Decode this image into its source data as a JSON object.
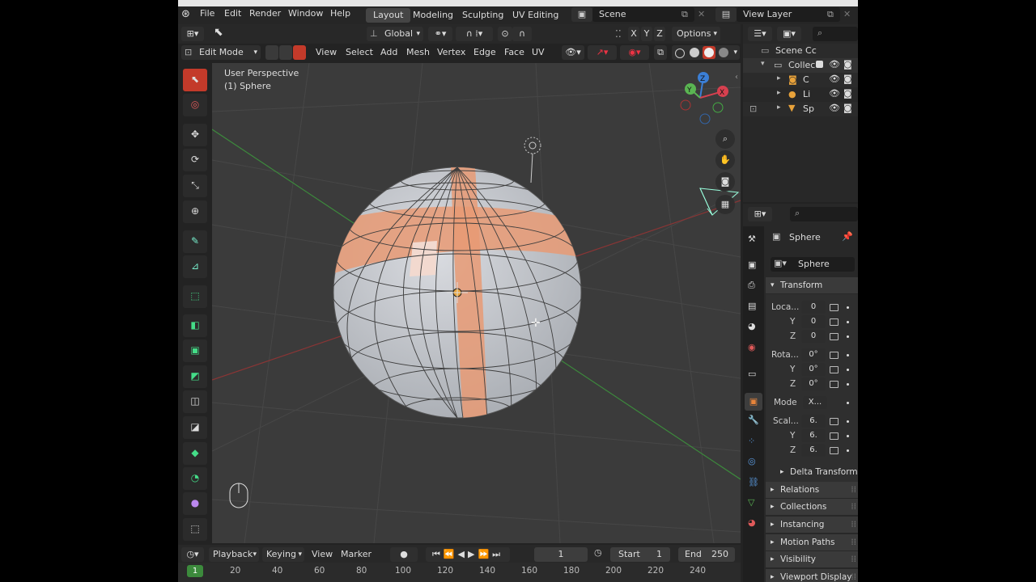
{
  "topbar": {
    "menus": [
      "File",
      "Edit",
      "Render",
      "Window",
      "Help"
    ],
    "workspaces": [
      "Layout",
      "Modeling",
      "Sculpting",
      "UV Editing"
    ],
    "scene_label": "Scene",
    "view_layer_label": "View Layer"
  },
  "tool_header": {
    "orientation": "Global",
    "options_label": "Options",
    "axes": [
      "X",
      "Y",
      "Z"
    ]
  },
  "viewport_header": {
    "mode": "Edit Mode",
    "menus": [
      "View",
      "Select",
      "Add",
      "Mesh",
      "Vertex",
      "Edge",
      "Face",
      "UV"
    ]
  },
  "viewport": {
    "perspective_label": "User Perspective",
    "object_label": "(1) Sphere"
  },
  "gizmo": {
    "x": "X",
    "y": "Y",
    "z": "Z"
  },
  "outliner": {
    "scene_collection": "Scene Cc",
    "collection": "Collec",
    "items": [
      "C",
      "Li",
      "Sp"
    ]
  },
  "properties": {
    "object_name": "Sphere",
    "datablock_name": "Sphere",
    "transform_label": "Transform",
    "location_label": "Loca...",
    "rotation_label": "Rota...",
    "scale_label": "Scal...",
    "mode_label": "Mode",
    "mode_value": "X...",
    "y_label": "Y",
    "z_label": "Z",
    "location": [
      "0",
      "0",
      "0"
    ],
    "rotation": [
      "0°",
      "0°",
      "0°"
    ],
    "scale": [
      "6.",
      "6.",
      "6."
    ],
    "delta_transform": "Delta Transform",
    "collapsed_panels": [
      "Relations",
      "Collections",
      "Instancing",
      "Motion Paths",
      "Visibility",
      "Viewport Display"
    ]
  },
  "timeline": {
    "playback": "Playback",
    "keying": "Keying",
    "view": "View",
    "marker": "Marker",
    "current_frame": "1",
    "start_label": "Start",
    "start_value": "1",
    "end_label": "End",
    "end_value": "250",
    "frame_indicator": "1",
    "ticks": [
      "20",
      "40",
      "60",
      "80",
      "100",
      "120",
      "140",
      "160",
      "180",
      "200",
      "220",
      "240"
    ]
  },
  "colors": {
    "accent": "#c33a2a",
    "selection": "#e89a74",
    "active_tab": "#454545"
  }
}
